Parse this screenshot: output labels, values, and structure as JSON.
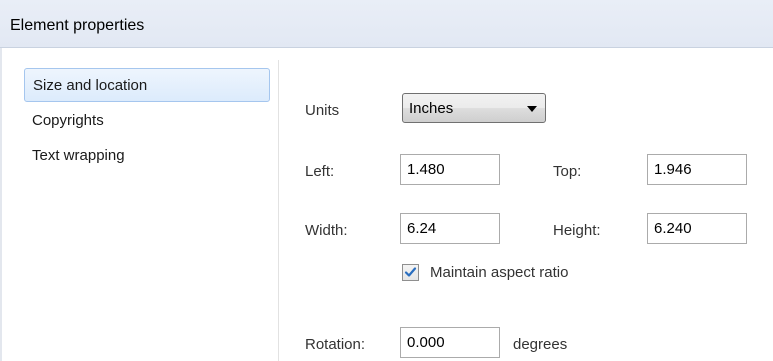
{
  "window": {
    "title": "Element properties"
  },
  "sidebar": {
    "items": [
      {
        "label": "Size and location",
        "selected": true
      },
      {
        "label": "Copyrights",
        "selected": false
      },
      {
        "label": "Text wrapping",
        "selected": false
      }
    ]
  },
  "form": {
    "units_label": "Units",
    "units_value": "Inches",
    "left_label": "Left:",
    "left_value": "1.480",
    "top_label": "Top:",
    "top_value": "1.946",
    "width_label": "Width:",
    "width_value": "6.24",
    "height_label": "Height:",
    "height_value": "6.240",
    "maintain_aspect_label": "Maintain aspect ratio",
    "maintain_aspect_checked": true,
    "rotation_label": "Rotation:",
    "rotation_value": "0.000",
    "rotation_unit": "degrees"
  },
  "colors": {
    "selection_bg": "#dcebfc",
    "selection_border": "#a5c6ee",
    "check_mark": "#2a6ebf"
  },
  "icons": {
    "checkbox_mark": "checkmark-icon",
    "dropdown_arrow": "chevron-down-icon"
  }
}
